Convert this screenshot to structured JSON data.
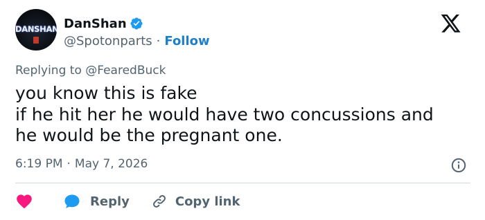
{
  "author": {
    "display_name": "DanShan",
    "handle": "@Spotonparts",
    "separator": "·",
    "follow_label": "Follow",
    "avatar_text": "DANSHAN",
    "verified_color": "#1d9bf0"
  },
  "reply_context": {
    "prefix": "Replying to",
    "mention": "@FearedBuck"
  },
  "tweet": {
    "lines": [
      "you know this is fake",
      "if he hit her he would have two concussions and",
      "he would be the pregnant one."
    ]
  },
  "meta": {
    "time": "6:19 PM",
    "separator": "·",
    "date": "May 7, 2026"
  },
  "actions": {
    "like_color": "#f91880",
    "reply_label": "Reply",
    "reply_color": "#1d9bf0",
    "copy_link_label": "Copy link"
  },
  "icons": {
    "brand": "x-logo-icon",
    "verified": "verified-badge-icon",
    "info": "info-icon",
    "like": "heart-icon",
    "reply": "reply-bubble-icon",
    "copy": "link-icon"
  }
}
